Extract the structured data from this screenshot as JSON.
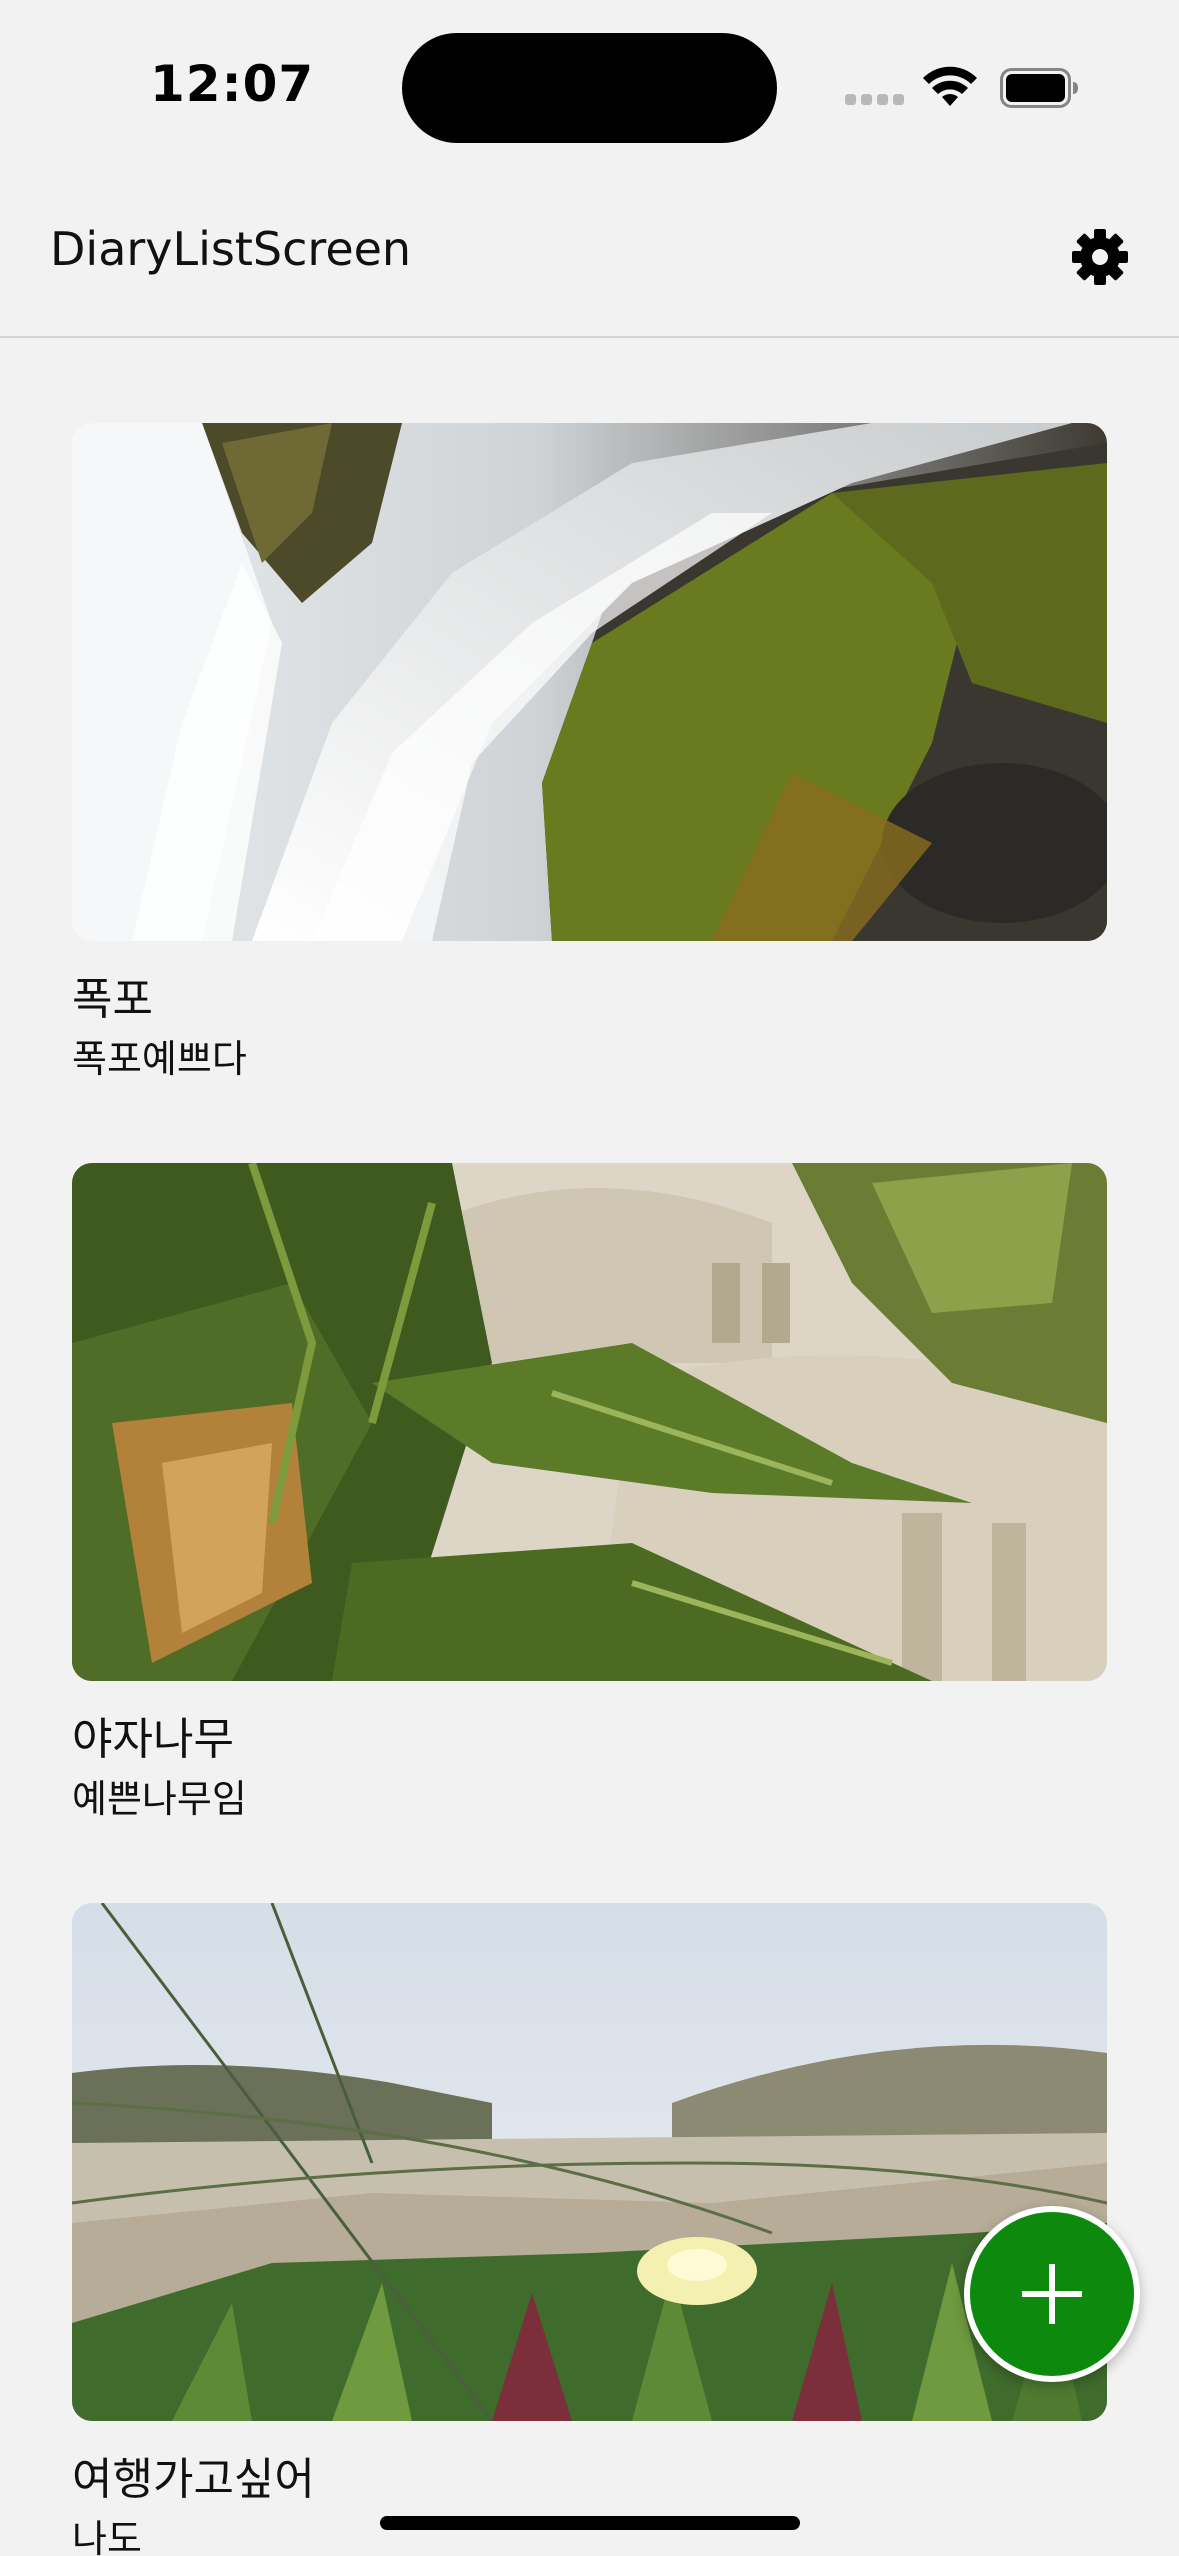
{
  "status_bar": {
    "time": "12:07",
    "icons": [
      "signal-icon",
      "wifi-icon",
      "battery-icon"
    ]
  },
  "nav": {
    "title": "DiaryListScreen",
    "settings_icon": "gear-icon"
  },
  "diary_entries": [
    {
      "title": "폭포",
      "description": "폭포예쁘다",
      "image": "waterfall-photo"
    },
    {
      "title": "야자나무",
      "description": "예쁜나무임",
      "image": "palm-tree-mosque-photo"
    },
    {
      "title": "여행가고싶어",
      "description": "나도",
      "image": "beach-flower-photo"
    }
  ],
  "fab": {
    "icon": "plus-icon"
  },
  "colors": {
    "background": "#f2f2f2",
    "fab": "#0d8a0d",
    "divider": "#d4d4d4",
    "text": "#111111"
  }
}
